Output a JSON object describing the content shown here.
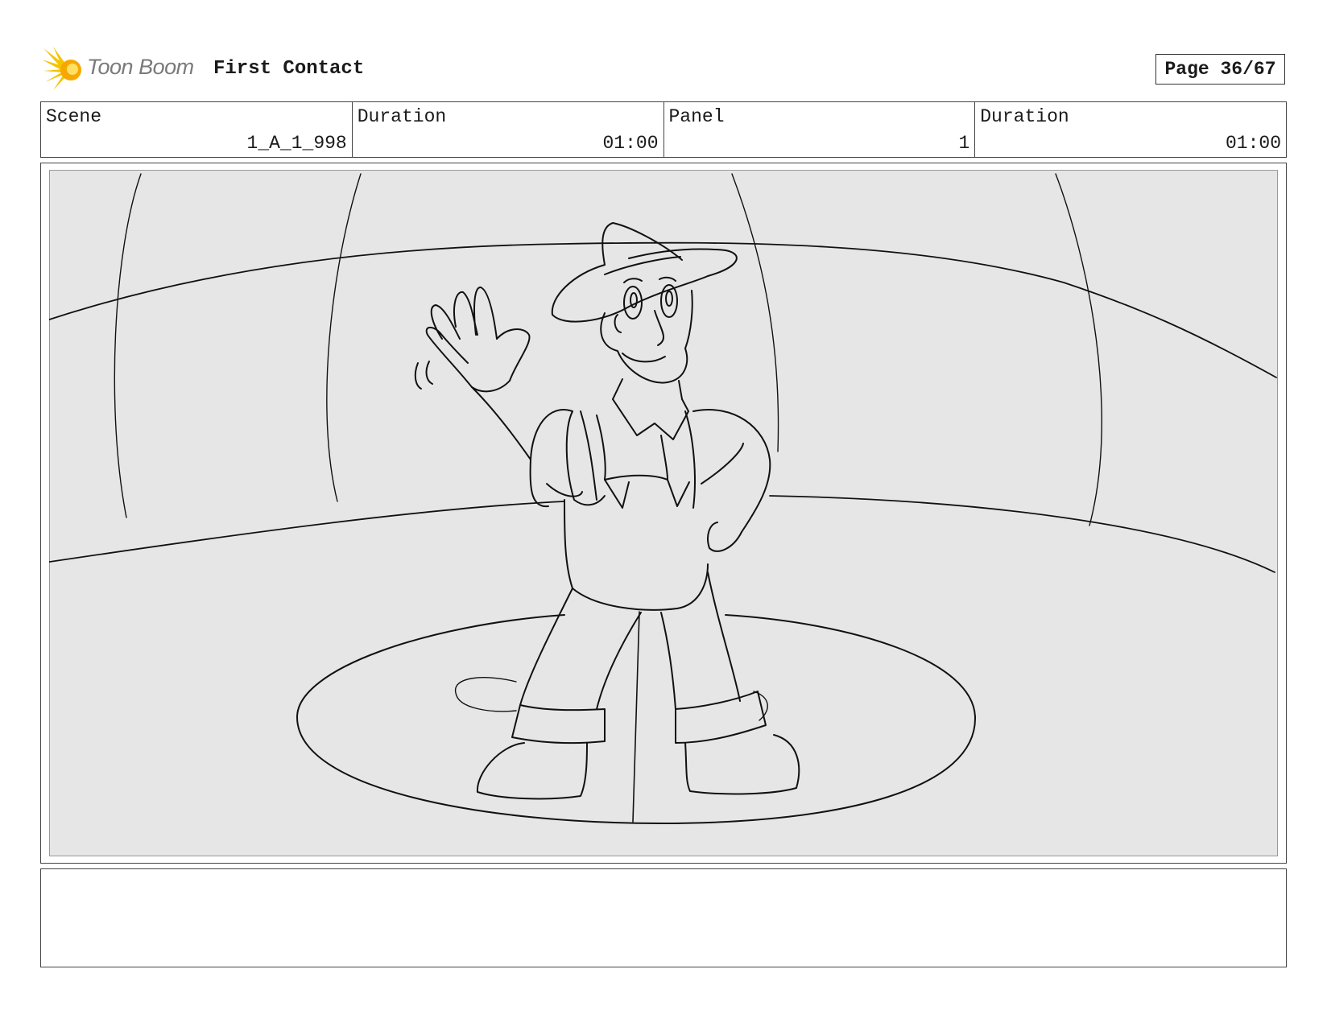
{
  "header": {
    "logo_text": "Toon Boom",
    "project_title": "First Contact",
    "page_label": "Page 36/67"
  },
  "info": {
    "scene_label": "Scene",
    "scene_value": "1_A_1_998",
    "scene_duration_label": "Duration",
    "scene_duration_value": "01:00",
    "panel_label": "Panel",
    "panel_value": "1",
    "panel_duration_label": "Duration",
    "panel_duration_value": "01:00"
  },
  "panel": {
    "background_color": "#e6e6e6",
    "line_color": "#111111"
  },
  "notes": {
    "text": ""
  }
}
